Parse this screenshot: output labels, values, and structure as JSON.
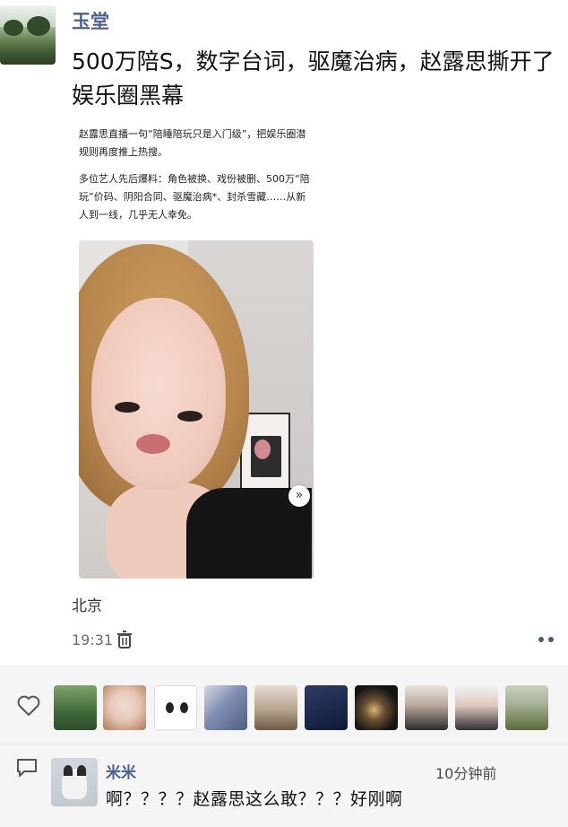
{
  "post": {
    "author": "玉堂",
    "title": "500万陪S，数字台词，驱魔治病，赵露思撕开了娱乐圈黑幕",
    "article_paragraphs": [
      "赵露思直播一句“陪睡陪玩只是入门级”，把娱乐圈潜规则再度推上热搜。",
      "多位艺人先后爆料：角色被换、戏份被删、500万“陪玩”价码、阴阳合同、驱魔治病*、封杀雪藏……从新人到一线，几乎无人幸免。"
    ],
    "location": "北京",
    "time": "19:31",
    "video": {
      "expand_icon": "chevron-double-down-icon"
    }
  },
  "actions": {
    "delete_icon": "trash-icon",
    "more_icon": "more-dots-icon"
  },
  "likes": {
    "heart_icon": "heart-outline-icon",
    "avatars": [
      {
        "name": "like-avatar-landscape",
        "colors": [
          "#3f6a3a",
          "#6d8f52"
        ]
      },
      {
        "name": "like-avatar-girl",
        "colors": [
          "#e6c8b8",
          "#b07a58"
        ]
      },
      {
        "name": "like-avatar-cartoon",
        "colors": [
          "#ffffff",
          "#222222"
        ]
      },
      {
        "name": "like-avatar-anime",
        "colors": [
          "#4d5f86",
          "#d8d8e6"
        ]
      },
      {
        "name": "like-avatar-food",
        "colors": [
          "#d8cfc4",
          "#6e5a45"
        ]
      },
      {
        "name": "like-avatar-night",
        "colors": [
          "#0f1a35",
          "#2d3b66"
        ]
      },
      {
        "name": "like-avatar-dark-cat",
        "colors": [
          "#141414",
          "#d9b37a"
        ]
      },
      {
        "name": "like-avatar-man",
        "colors": [
          "#e8e4e0",
          "#2b2b2b"
        ]
      },
      {
        "name": "like-avatar-woman",
        "colors": [
          "#eef3f6",
          "#2f2f35"
        ]
      },
      {
        "name": "like-avatar-field",
        "colors": [
          "#a9b39a",
          "#5a6a3a"
        ]
      }
    ]
  },
  "comment": {
    "icon": "comment-outline-icon",
    "author": "米米",
    "time": "10分钟前",
    "text": "啊？？？？赵露思这么敢？？？好刚啊"
  },
  "colors": {
    "name_blue": "#4b5f8a",
    "panel_bg": "#f5f5f5"
  }
}
